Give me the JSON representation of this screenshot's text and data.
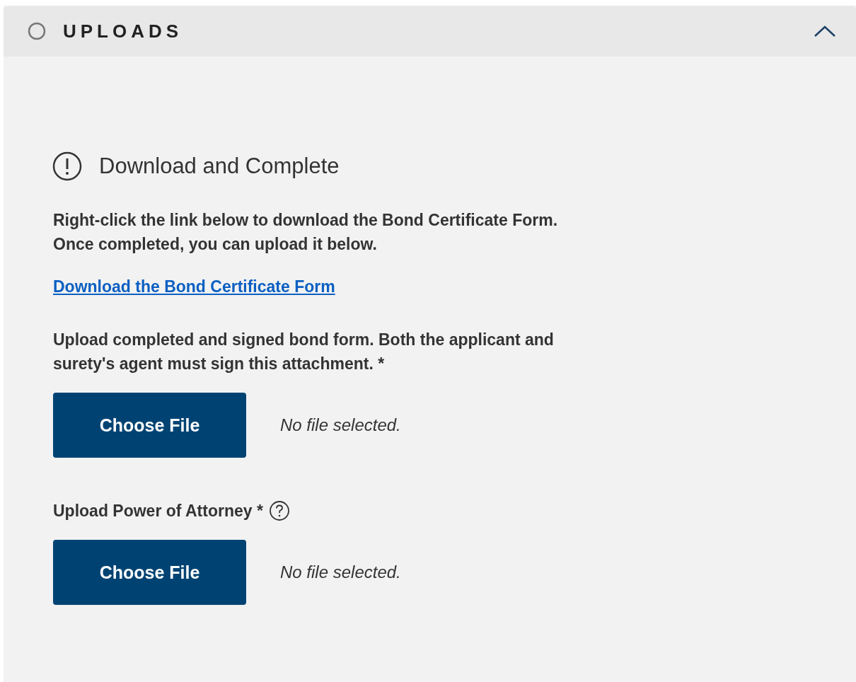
{
  "section": {
    "title": "UPLOADS",
    "completed": false,
    "expanded": true
  },
  "notice": {
    "heading": "Download and Complete",
    "text": "Right-click the link below to download the Bond Certificate Form.\nOnce completed, you can upload it below.",
    "link": "Download the Bond Certificate Form"
  },
  "uploads": [
    {
      "label": "Upload completed and signed bond form. Both the applicant and surety's agent must sign this attachment. *",
      "help": false,
      "button": "Choose File",
      "status": "No file selected."
    },
    {
      "label": "Upload Power of Attorney *",
      "help": true,
      "button": "Choose File",
      "status": "No file selected."
    }
  ]
}
